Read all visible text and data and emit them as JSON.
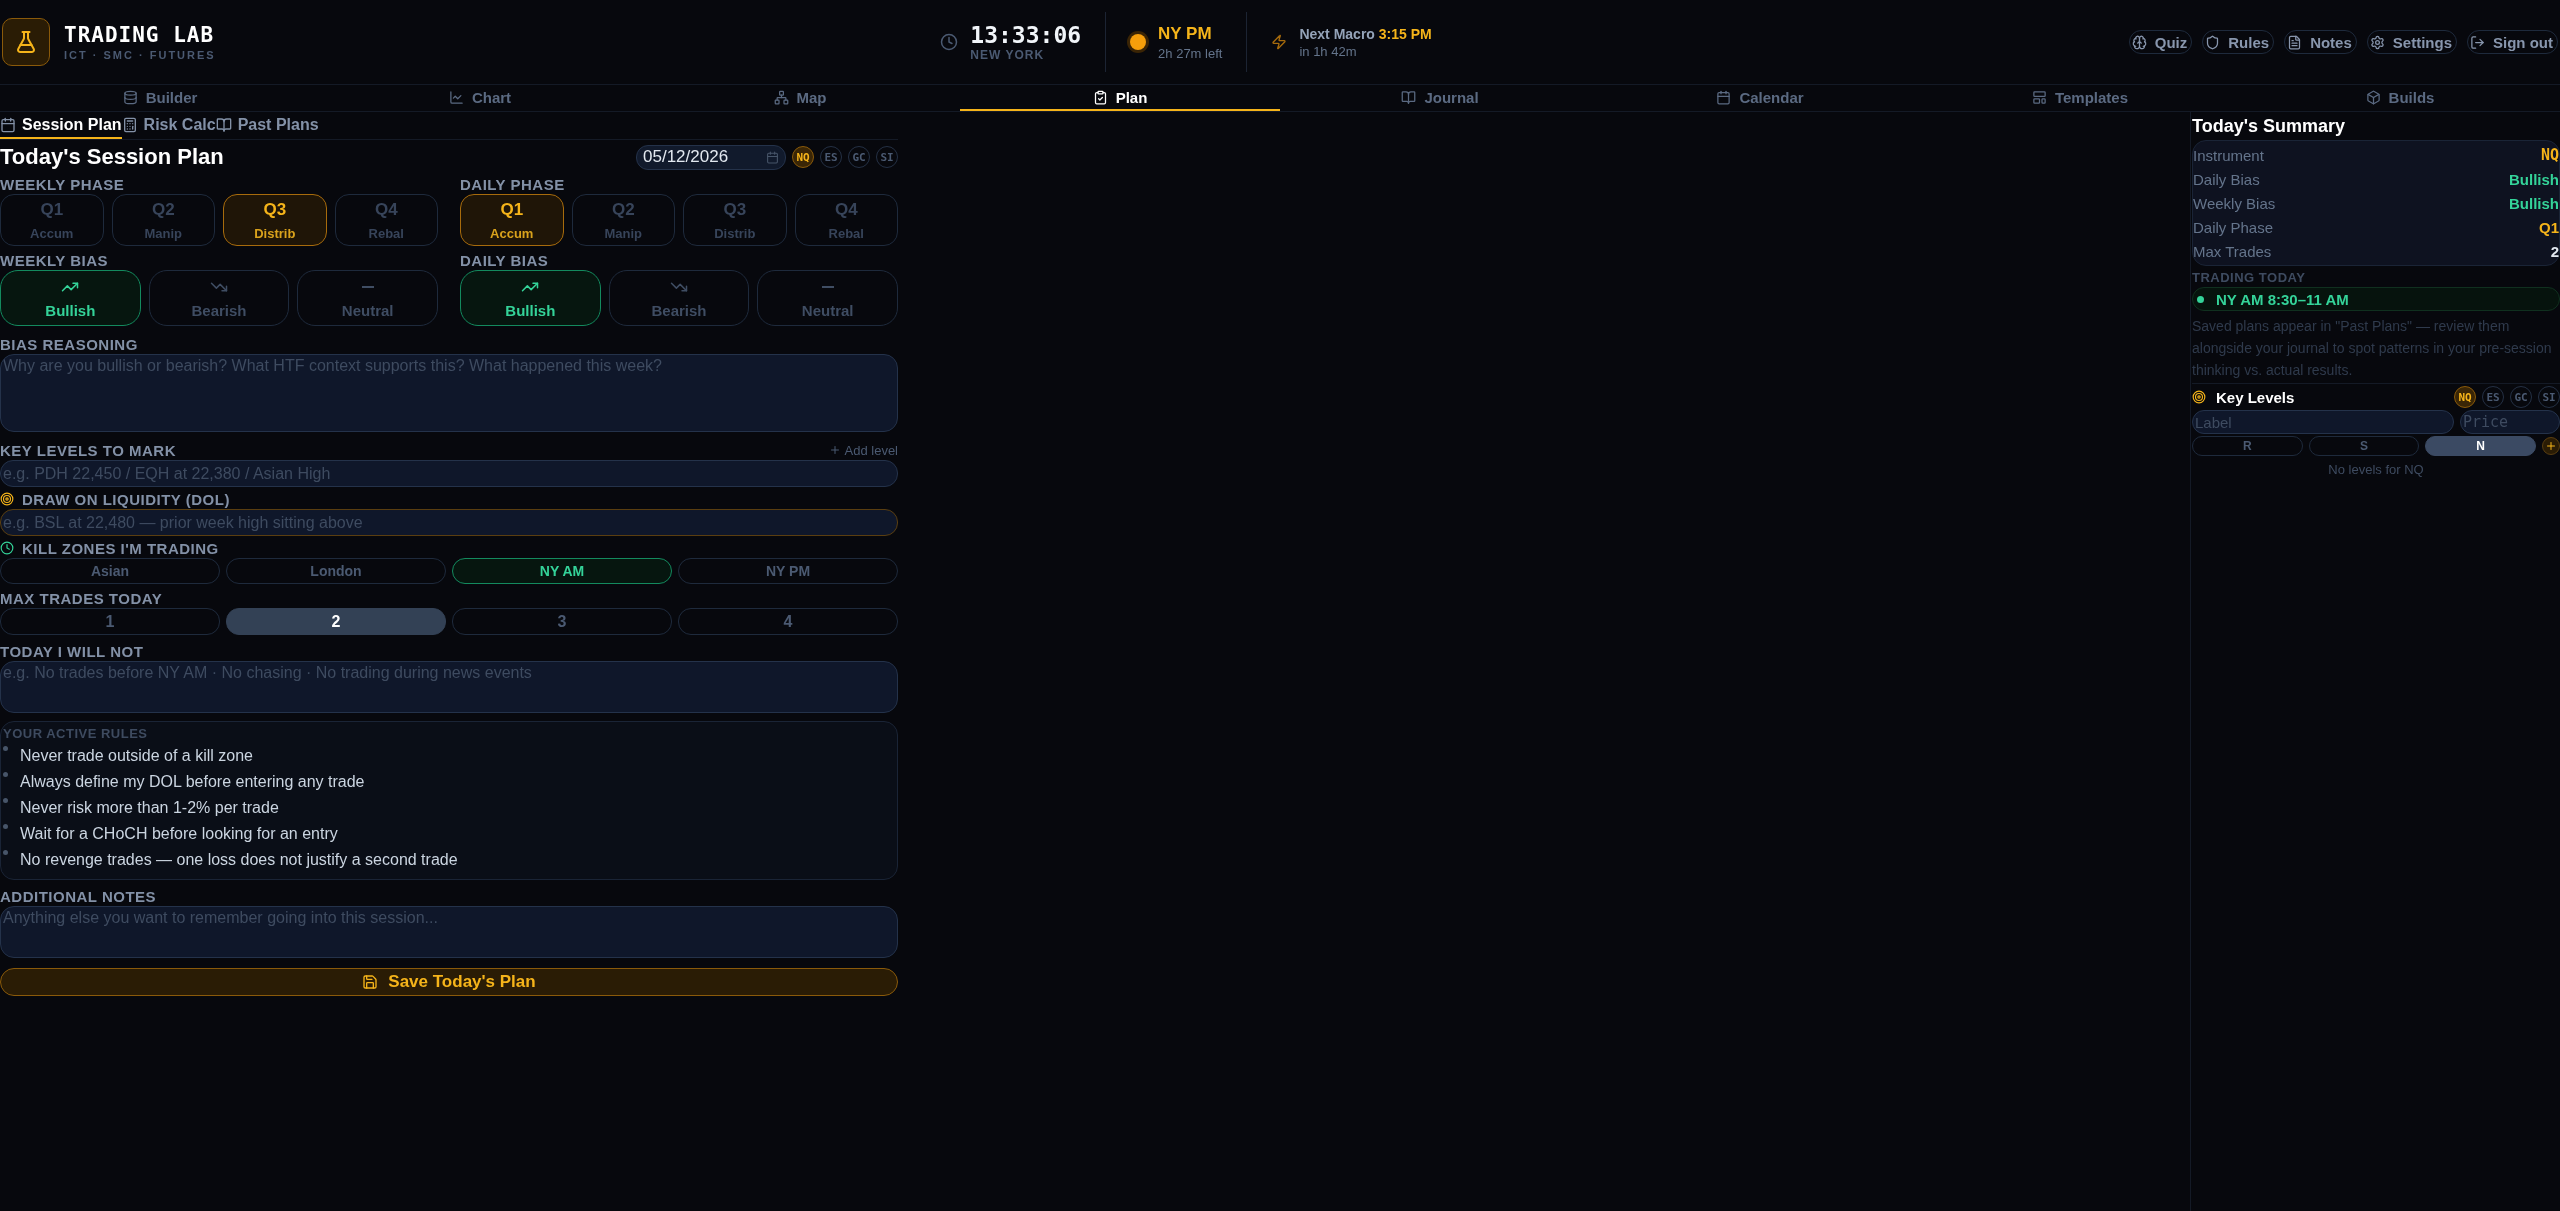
{
  "app": {
    "title": "TRADING LAB",
    "subtitle": "ICT · SMC · FUTURES"
  },
  "clock": {
    "time": "13:33:06",
    "zone": "NEW YORK"
  },
  "session": {
    "name": "NY PM",
    "remaining": "2h 27m left",
    "color": "#f59e0b"
  },
  "macro": {
    "label": "Next Macro",
    "time": "3:15 PM",
    "countdown": "in 1h 42m"
  },
  "header_buttons": [
    {
      "label": "Quiz"
    },
    {
      "label": "Rules"
    },
    {
      "label": "Notes"
    },
    {
      "label": "Settings"
    },
    {
      "label": "Sign out"
    }
  ],
  "nav_tabs": [
    {
      "label": "Builder",
      "selected": false
    },
    {
      "label": "Chart",
      "selected": false
    },
    {
      "label": "Map",
      "selected": false
    },
    {
      "label": "Plan",
      "selected": true
    },
    {
      "label": "Journal",
      "selected": false
    },
    {
      "label": "Calendar",
      "selected": false
    },
    {
      "label": "Templates",
      "selected": false
    },
    {
      "label": "Builds",
      "selected": false
    }
  ],
  "sub_tabs": [
    {
      "label": "Session Plan",
      "selected": true
    },
    {
      "label": "Risk Calc",
      "selected": false
    },
    {
      "label": "Past Plans",
      "selected": false
    }
  ],
  "plan": {
    "title": "Today's Session Plan",
    "date": "05/12/2026",
    "instruments": [
      {
        "label": "NQ",
        "selected": true
      },
      {
        "label": "ES",
        "selected": false
      },
      {
        "label": "GC",
        "selected": false
      },
      {
        "label": "SI",
        "selected": false
      }
    ],
    "phase_groups": [
      {
        "label": "WEEKLY PHASE",
        "options": [
          {
            "q": "Q1",
            "name": "Accum",
            "selected": false
          },
          {
            "q": "Q2",
            "name": "Manip",
            "selected": false
          },
          {
            "q": "Q3",
            "name": "Distrib",
            "selected": true
          },
          {
            "q": "Q4",
            "name": "Rebal",
            "selected": false
          }
        ]
      },
      {
        "label": "DAILY PHASE",
        "options": [
          {
            "q": "Q1",
            "name": "Accum",
            "selected": true
          },
          {
            "q": "Q2",
            "name": "Manip",
            "selected": false
          },
          {
            "q": "Q3",
            "name": "Distrib",
            "selected": false
          },
          {
            "q": "Q4",
            "name": "Rebal",
            "selected": false
          }
        ]
      }
    ],
    "bias_groups": [
      {
        "label": "WEEKLY BIAS",
        "options": [
          {
            "kind": "up",
            "label": "Bullish",
            "selected": true
          },
          {
            "kind": "down",
            "label": "Bearish",
            "selected": false
          },
          {
            "kind": "flat",
            "label": "Neutral",
            "selected": false
          }
        ]
      },
      {
        "label": "DAILY BIAS",
        "options": [
          {
            "kind": "up",
            "label": "Bullish",
            "selected": true
          },
          {
            "kind": "down",
            "label": "Bearish",
            "selected": false
          },
          {
            "kind": "flat",
            "label": "Neutral",
            "selected": false
          }
        ]
      }
    ],
    "reasoning": {
      "label": "BIAS REASONING",
      "placeholder": "Why are you bullish or bearish? What HTF context supports this? What happened this week?"
    },
    "key_levels": {
      "label": "KEY LEVELS TO MARK",
      "add": "Add level",
      "placeholder": "e.g. PDH 22,450 / EQH at 22,380 / Asian High"
    },
    "dol": {
      "label": "DRAW ON LIQUIDITY (DOL)",
      "placeholder": "e.g. BSL at 22,480 — prior week high sitting above"
    },
    "kill_zones": {
      "label": "KILL ZONES I'M TRADING",
      "options": [
        {
          "label": "Asian",
          "selected": false
        },
        {
          "label": "London",
          "selected": false
        },
        {
          "label": "NY AM",
          "selected": true
        },
        {
          "label": "NY PM",
          "selected": false
        }
      ]
    },
    "max_trades": {
      "label": "MAX TRADES TODAY",
      "options": [
        {
          "label": "1",
          "selected": false
        },
        {
          "label": "2",
          "selected": true
        },
        {
          "label": "3",
          "selected": false
        },
        {
          "label": "4",
          "selected": false
        }
      ]
    },
    "will_not": {
      "label": "TODAY I WILL NOT",
      "placeholder": "e.g. No trades before NY AM · No chasing · No trading during news events"
    },
    "rules": {
      "label": "YOUR ACTIVE RULES",
      "items": [
        "Never trade outside of a kill zone",
        "Always define my DOL before entering any trade",
        "Never risk more than 1-2% per trade",
        "Wait for a CHoCH before looking for an entry",
        "No revenge trades — one loss does not justify a second trade"
      ]
    },
    "notes": {
      "label": "ADDITIONAL NOTES",
      "placeholder": "Anything else you want to remember going into this session..."
    },
    "save": "Save Today's Plan"
  },
  "summary": {
    "title": "Today's Summary",
    "rows": [
      {
        "label": "Instrument",
        "value": "NQ",
        "color": "#f5b41a"
      },
      {
        "label": "Daily Bias",
        "value": "Bullish",
        "color": "#34d399"
      },
      {
        "label": "Weekly Bias",
        "value": "Bullish",
        "color": "#34d399"
      },
      {
        "label": "Daily Phase",
        "value": "Q1",
        "color": "#f5b41a"
      },
      {
        "label": "Max Trades",
        "value": "2",
        "color": "#e2e8f0"
      }
    ],
    "trading_label": "TRADING TODAY",
    "trading": [
      "NY AM 8:30–11 AM"
    ],
    "note": "Saved plans appear in \"Past Plans\" — review them alongside your journal to spot patterns in your pre-session thinking vs. actual results.",
    "key_levels": {
      "title": "Key Levels",
      "instruments": [
        {
          "label": "NQ",
          "selected": true
        },
        {
          "label": "ES",
          "selected": false
        },
        {
          "label": "GC",
          "selected": false
        },
        {
          "label": "SI",
          "selected": false
        }
      ],
      "label_placeholder": "Label",
      "price_placeholder": "Price",
      "types": [
        {
          "label": "R",
          "selected": false
        },
        {
          "label": "S",
          "selected": false
        },
        {
          "label": "N",
          "selected": true
        }
      ],
      "empty": "No levels for NQ"
    }
  }
}
